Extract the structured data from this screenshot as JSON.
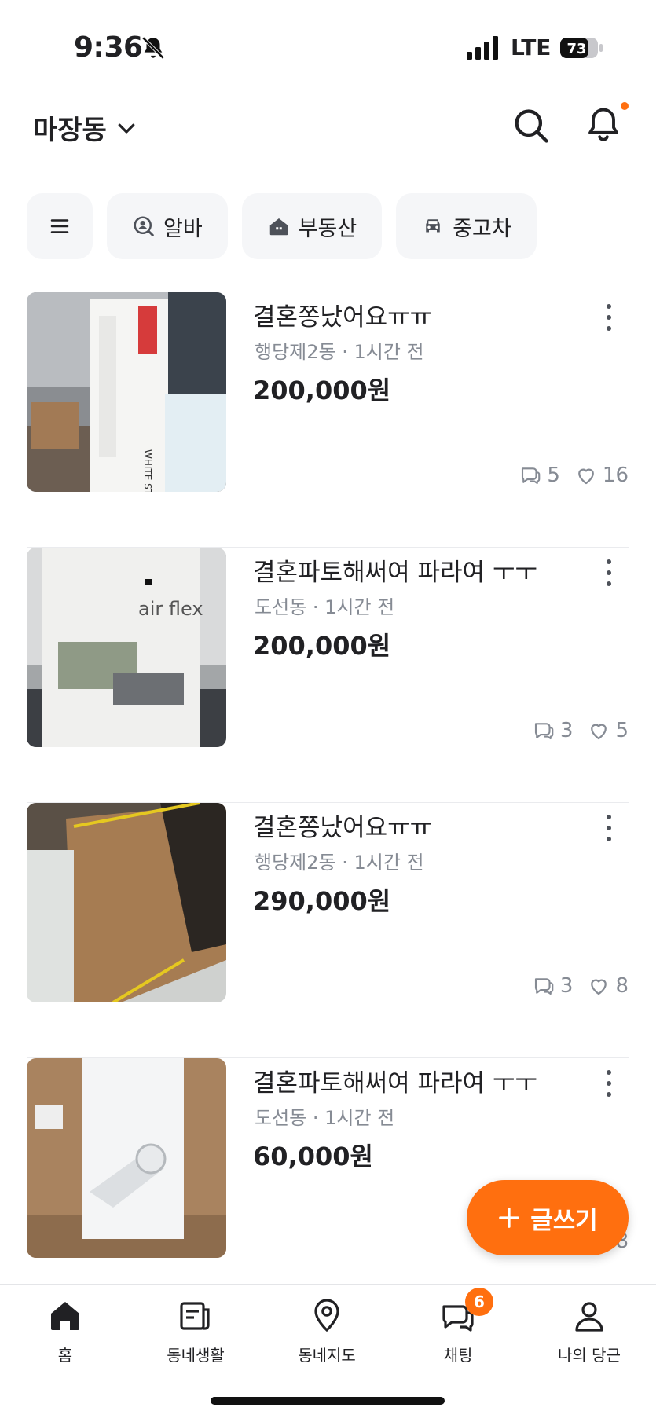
{
  "status_bar": {
    "time": "9:36",
    "network": "LTE",
    "battery": "73"
  },
  "header": {
    "location": "마장동"
  },
  "chips": [
    {
      "label": "알바",
      "icon": "search-person-icon"
    },
    {
      "label": "부동산",
      "icon": "house-icon"
    },
    {
      "label": "중고차",
      "icon": "car-icon"
    }
  ],
  "items": [
    {
      "title": "결혼쫑났어요ㅠㅠ",
      "meta": "행당제2동 · 1시간 전",
      "price": "200,000원",
      "comments": "5",
      "likes": "16"
    },
    {
      "title": "결혼파토해써여 파라여 ㅜㅜ",
      "meta": "도선동 · 1시간 전",
      "price": "200,000원",
      "comments": "3",
      "likes": "5"
    },
    {
      "title": "결혼쫑났어요ㅠㅠ",
      "meta": "행당제2동 · 1시간 전",
      "price": "290,000원",
      "comments": "3",
      "likes": "8"
    },
    {
      "title": "결혼파토해써여 파라여 ㅜㅜ",
      "meta": "도선동 · 1시간 전",
      "price": "60,000원",
      "comments": "",
      "likes": "8"
    }
  ],
  "fab": {
    "label": "글쓰기"
  },
  "bottom_nav": {
    "home": "홈",
    "community": "동네생활",
    "map": "동네지도",
    "chat": "채팅",
    "chat_badge": "6",
    "my": "나의 당근"
  },
  "colors": {
    "accent": "#ff6f0f",
    "text": "#212124",
    "muted": "#868b94",
    "chip_bg": "#f5f6f8"
  }
}
